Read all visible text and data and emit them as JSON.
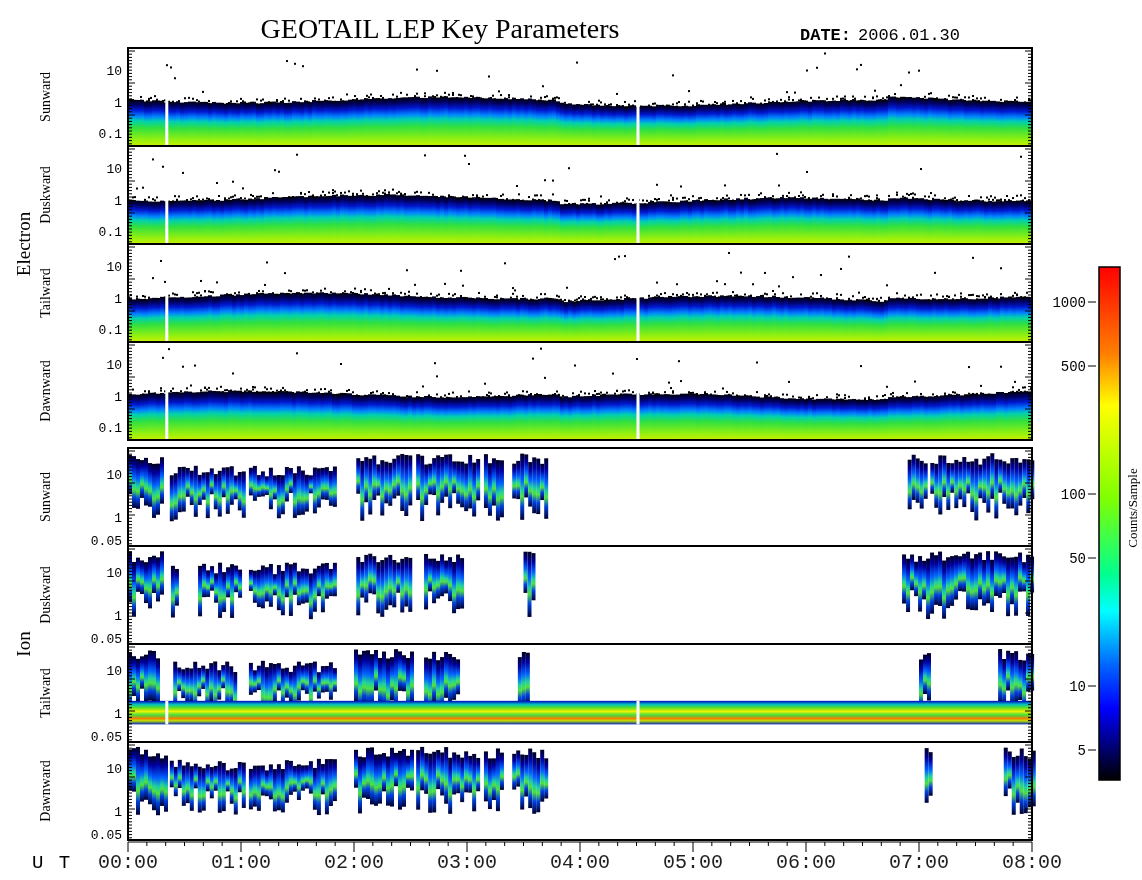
{
  "title": "GEOTAIL LEP Key Parameters",
  "date": {
    "label": "DATE:",
    "value": "2006.01.30"
  },
  "groups": [
    {
      "label": "Electron",
      "kind": "electron",
      "panels": [
        {
          "label": "Sunward",
          "yticks": [
            "10",
            "1",
            "0.1"
          ]
        },
        {
          "label": "Duskward",
          "yticks": [
            "10",
            "1",
            "0.1"
          ]
        },
        {
          "label": "Tailward",
          "yticks": [
            "10",
            "1",
            "0.1"
          ]
        },
        {
          "label": "Dawnward",
          "yticks": [
            "10",
            "1",
            "0.1"
          ]
        }
      ]
    },
    {
      "label": "Ion",
      "kind": "ion",
      "panels": [
        {
          "label": "Sunward",
          "yticks": [
            "10",
            "1",
            "0.05"
          ]
        },
        {
          "label": "Duskward",
          "yticks": [
            "10",
            "1",
            "0.05"
          ]
        },
        {
          "label": "Tailward",
          "yticks": [
            "10",
            "1",
            "0.05"
          ]
        },
        {
          "label": "Dawnward",
          "yticks": [
            "10",
            "1",
            "0.05"
          ]
        }
      ]
    }
  ],
  "x_axis": {
    "label": "U T",
    "ticks": [
      "00:00",
      "01:00",
      "02:00",
      "03:00",
      "04:00",
      "05:00",
      "06:00",
      "07:00",
      "08:00"
    ]
  },
  "colorbar": {
    "label": "Counts/Sample",
    "ticks": [
      "1000",
      "500",
      "100",
      "50",
      "10",
      "5"
    ]
  }
}
